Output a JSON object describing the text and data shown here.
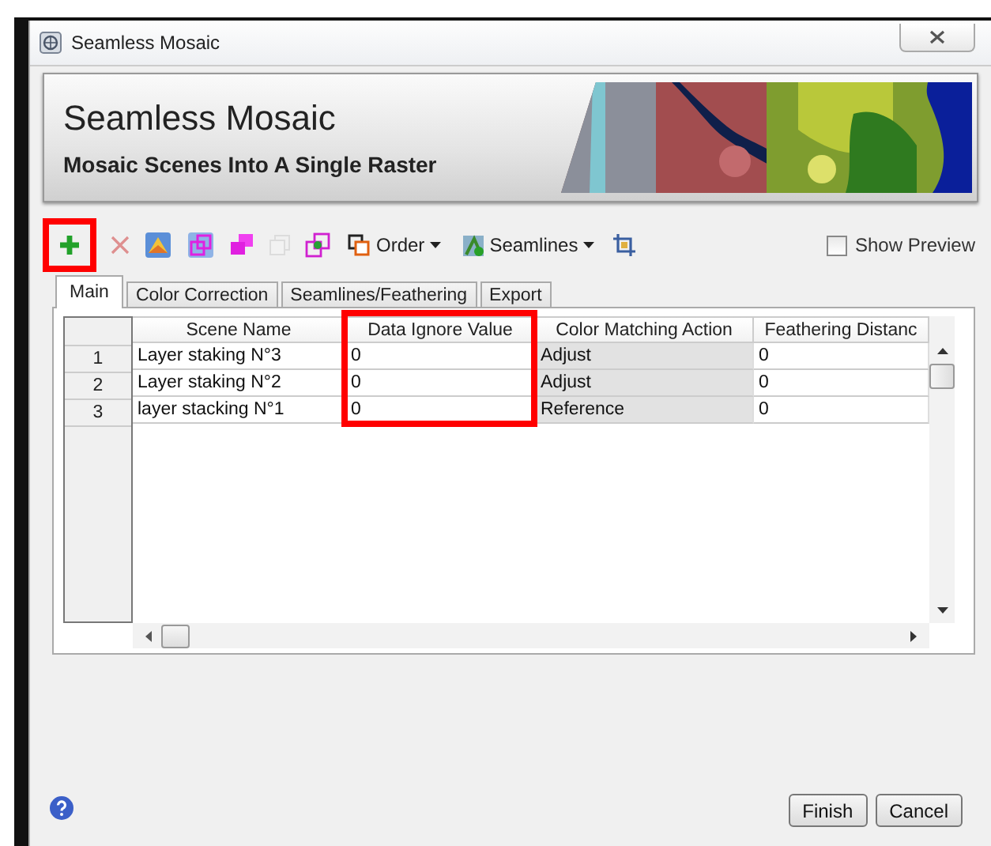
{
  "window": {
    "title": "Seamless Mosaic"
  },
  "banner": {
    "title": "Seamless Mosaic",
    "subtitle": "Mosaic Scenes Into A Single Raster",
    "kind": "picture"
  },
  "toolbar": {
    "icon_buttons": [
      {
        "disabled": false,
        "highlighted": true
      },
      {
        "disabled": true,
        "highlighted": false
      },
      {
        "disabled": false,
        "highlighted": false
      },
      {
        "disabled": false,
        "highlighted": false
      },
      {
        "disabled": false,
        "highlighted": false
      },
      {
        "disabled": true,
        "highlighted": false
      },
      {
        "disabled": false,
        "highlighted": false
      }
    ],
    "dropdowns": [
      {
        "label": "Order"
      },
      {
        "label": "Seamlines"
      }
    ],
    "show_preview": {
      "label": "Show Preview",
      "checked": false
    }
  },
  "tabs": [
    {
      "label": "Main",
      "selected": true
    },
    {
      "label": "Color Correction",
      "selected": false
    },
    {
      "label": "Seamlines/Feathering",
      "selected": false
    },
    {
      "label": "Export",
      "selected": false
    }
  ],
  "table": {
    "columns": [
      {
        "label": "Scene Name",
        "readonly": false,
        "highlighted": false
      },
      {
        "label": "Data Ignore Value",
        "readonly": false,
        "highlighted": true
      },
      {
        "label": "Color Matching Action",
        "readonly": true,
        "highlighted": false
      },
      {
        "label": "Feathering Distanc",
        "readonly": false,
        "highlighted": false
      }
    ],
    "rows": [
      {
        "number": "1",
        "cells": [
          "Layer staking N°3",
          "0",
          "Adjust",
          "0"
        ]
      },
      {
        "number": "2",
        "cells": [
          "Layer staking N°2",
          "0",
          "Adjust",
          "0"
        ]
      },
      {
        "number": "3",
        "cells": [
          "layer stacking N°1",
          "0",
          "Reference",
          "0"
        ]
      }
    ]
  },
  "buttons": [
    {
      "label": "Finish"
    },
    {
      "label": "Cancel"
    }
  ]
}
